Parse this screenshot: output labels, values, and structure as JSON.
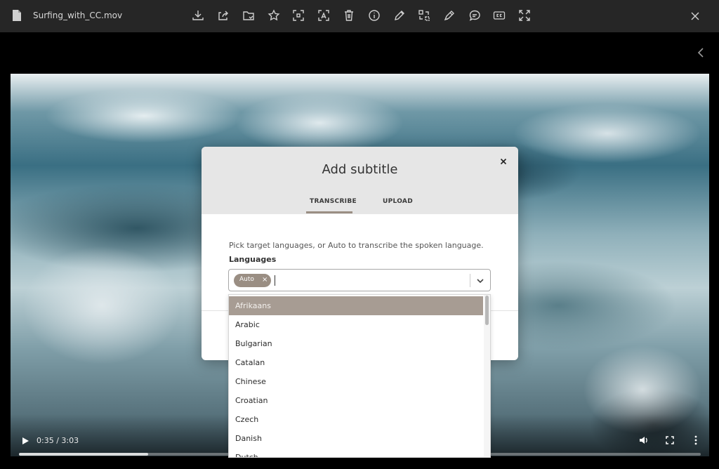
{
  "window": {
    "filename": "Surfing_with_CC.mov"
  },
  "toolbar": {
    "icons": [
      "download-icon",
      "share-icon",
      "move-to-folder-icon",
      "star-icon",
      "focus-icon",
      "ocr-icon",
      "trash-icon",
      "info-icon",
      "edit-icon",
      "transform-icon",
      "annotate-icon",
      "comment-icon",
      "closed-captions-icon",
      "fullscreen-icon"
    ]
  },
  "video": {
    "time": "0:35 / 3:03",
    "progress": 0.19
  },
  "dialog": {
    "title": "Add subtitle",
    "tabs": [
      {
        "label": "TRANSCRIBE",
        "active": true
      },
      {
        "label": "UPLOAD",
        "active": false
      }
    ],
    "instruction": "Pick target languages, or Auto to transcribe the spoken language.",
    "languages_label": "Languages",
    "selected_chip": "Auto",
    "chip_remove": "×"
  },
  "dropdown": {
    "items": [
      "Afrikaans",
      "Arabic",
      "Bulgarian",
      "Catalan",
      "Chinese",
      "Croatian",
      "Czech",
      "Danish",
      "Dutch"
    ],
    "highlighted": "Afrikaans"
  },
  "colors": {
    "accent": "#9a8e83",
    "toolbar_bg": "#262626",
    "dialog_header": "#e6e6e6"
  }
}
